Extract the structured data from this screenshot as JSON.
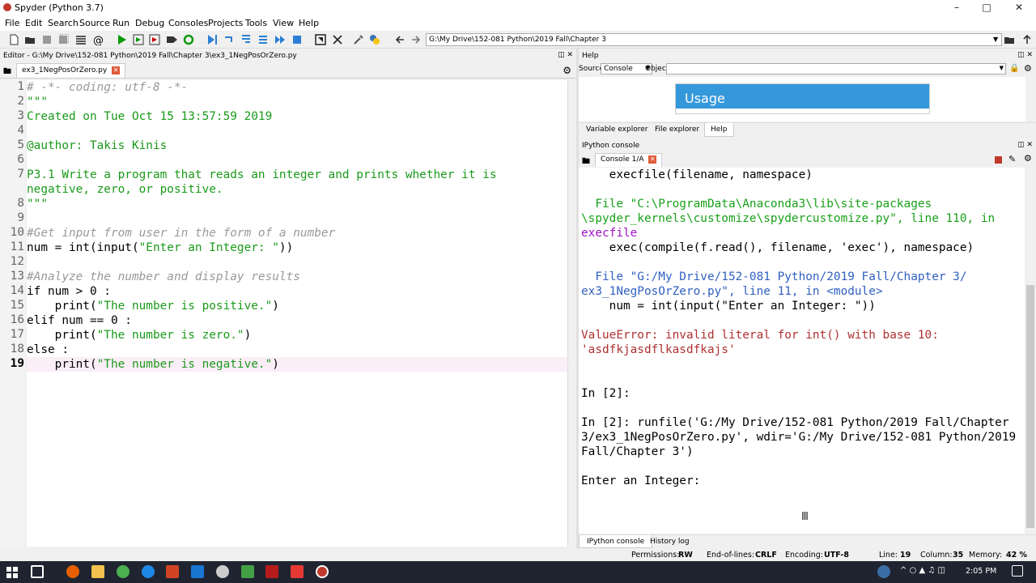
{
  "window": {
    "title": "Spyder (Python 3.7)"
  },
  "menu": [
    "File",
    "Edit",
    "Search",
    "Source",
    "Run",
    "Debug",
    "Consoles",
    "Projects",
    "Tools",
    "View",
    "Help"
  ],
  "toolbar": {
    "path": "G:\\My Drive\\152-081 Python\\2019 Fall\\Chapter 3"
  },
  "editor": {
    "title": "Editor - G:\\My Drive\\152-081 Python\\2019 Fall\\Chapter 3\\ex3_1NegPosOrZero.py",
    "tab": "ex3_1NegPosOrZero.py",
    "line_numbers": [
      "1",
      "2",
      "3",
      "4",
      "5",
      "6",
      "7",
      "",
      "8",
      "9",
      "10",
      "11",
      "12",
      "13",
      "14",
      "15",
      "16",
      "17",
      "18",
      "19"
    ],
    "lines": [
      "# -*- coding: utf-8 -*-",
      "\"\"\"",
      "Created on Tue Oct 15 13:57:59 2019",
      "",
      "@author: Takis Kinis",
      "",
      "P3.1 Write a program that reads an integer and prints whether it is",
      "negative, zero, or positive.",
      "\"\"\"",
      "",
      "#Get input from user in the form of a number",
      "num = int(input(\"Enter an Integer: \"))",
      "",
      "#Analyze the number and display results",
      "if num > 0 :",
      "    print(\"The number is positive.\")",
      "elif num == 0 :",
      "    print(\"The number is zero.\")",
      "else :",
      "    print(\"The number is negative.\")"
    ]
  },
  "help": {
    "title": "Help",
    "source_label": "Source",
    "source_value": "Console",
    "object_label": "Object",
    "usage_heading": "Usage",
    "tabs": [
      "Variable explorer",
      "File explorer",
      "Help"
    ]
  },
  "console": {
    "title": "IPython console",
    "tab": "Console 1/A",
    "lines": [
      "    execfile(filename, namespace)",
      "",
      "  File \"C:\\ProgramData\\Anaconda3\\lib\\site-packages",
      "\\spyder_kernels\\customize\\spydercustomize.py\", line 110, in",
      "execfile",
      "    exec(compile(f.read(), filename, 'exec'), namespace)",
      "",
      "  File \"G:/My Drive/152-081 Python/2019 Fall/Chapter 3/",
      "ex3_1NegPosOrZero.py\", line 11, in <module>",
      "    num = int(input(\"Enter an Integer: \"))",
      "",
      "ValueError: invalid literal for int() with base 10:",
      "'asdfkjasdflkasdfkajs'",
      "",
      "",
      "In [2]:",
      "",
      "In [2]: runfile('G:/My Drive/152-081 Python/2019 Fall/Chapter",
      "3/ex3_1NegPosOrZero.py', wdir='G:/My Drive/152-081 Python/2019",
      "Fall/Chapter 3')",
      "",
      "Enter an Integer:"
    ],
    "bottom_tabs": [
      "IPython console",
      "History log"
    ]
  },
  "status": {
    "permissions_label": "Permissions:",
    "permissions": "RW",
    "eol_label": "End-of-lines:",
    "eol": "CRLF",
    "encoding_label": "Encoding:",
    "encoding": "UTF-8",
    "line_label": "Line:",
    "line": "19",
    "column_label": "Column:",
    "column": "35",
    "memory_label": "Memory:",
    "memory": "42 %"
  },
  "taskbar": {
    "time": "2:05 PM"
  },
  "colors": {
    "usage_header": "#3498db",
    "string_green": "#1a9a1a",
    "comment_gray": "#999999",
    "error_purple": "#a010c8"
  }
}
